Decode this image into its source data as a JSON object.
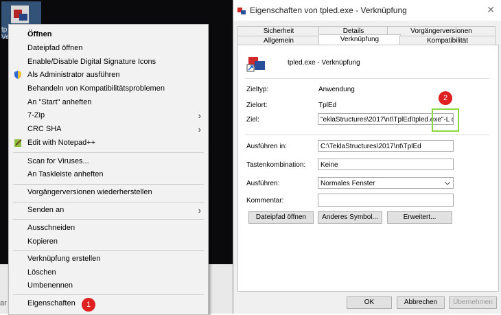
{
  "desktop": {
    "icon_label": "tp\nVe",
    "search_hint": "ar"
  },
  "context_menu": {
    "items": [
      {
        "label": "Öffnen",
        "bold": true
      },
      {
        "label": "Dateipfad öffnen"
      },
      {
        "label": "Enable/Disable Digital Signature Icons"
      },
      {
        "label": "Als Administrator ausführen",
        "icon": "shield-icon"
      },
      {
        "label": "Behandeln von Kompatibilitätsproblemen"
      },
      {
        "label": "An \"Start\" anheften"
      },
      {
        "label": "7-Zip",
        "submenu": true
      },
      {
        "label": "CRC SHA",
        "submenu": true
      },
      {
        "label": "Edit with Notepad++",
        "icon": "notepad-icon"
      },
      {
        "label": "Scan for Viruses..."
      },
      {
        "label": "An Taskleiste anheften"
      },
      {
        "label": "Vorgängerversionen wiederherstellen"
      },
      {
        "label": "Senden an",
        "submenu": true
      },
      {
        "label": "Ausschneiden"
      },
      {
        "label": "Kopieren"
      },
      {
        "label": "Verknüpfung erstellen"
      },
      {
        "label": "Löschen"
      },
      {
        "label": "Umbenennen"
      },
      {
        "label": "Eigenschaften"
      }
    ],
    "submenu_arrow": "›",
    "badge": "1"
  },
  "dialog": {
    "title": "Eigenschaften von tpled.exe - Verknüpfung",
    "close": "✕",
    "tabs_row1": [
      "Sicherheit",
      "Details",
      "Vorgängerversionen"
    ],
    "tabs_row2": [
      "Allgemein",
      "Verknüpfung",
      "Kompatibilität"
    ],
    "active_tab": "Verknüpfung",
    "file_name": "tpled.exe - Verknüpfung",
    "fields": {
      "zieltyp_label": "Zieltyp:",
      "zieltyp_value": "Anwendung",
      "zielort_label": "Zielort:",
      "zielort_value": "TplEd",
      "ziel_label": "Ziel:",
      "ziel_value": "\"eklaStructures\\2017\\nt\\TplEd\\tpled.exe\"",
      "ziel_suffix": "-L deu",
      "ausfuehren_in_label": "Ausführen in:",
      "ausfuehren_in_value": "C:\\TeklaStructures\\2017\\nt\\TplEd",
      "tasten_label": "Tastenkombination:",
      "tasten_value": "Keine",
      "ausfuehren_label": "Ausführen:",
      "ausfuehren_value": "Normales Fenster",
      "kommentar_label": "Kommentar:",
      "kommentar_value": ""
    },
    "badge": "2",
    "buttons": {
      "open_path": "Dateipfad öffnen",
      "other_symbol": "Anderes Symbol...",
      "advanced": "Erweitert...",
      "ok": "OK",
      "cancel": "Abbrechen",
      "apply": "Übernehmen"
    }
  },
  "colors": {
    "badge": "#e02020",
    "highlight": "#8cd63f"
  }
}
